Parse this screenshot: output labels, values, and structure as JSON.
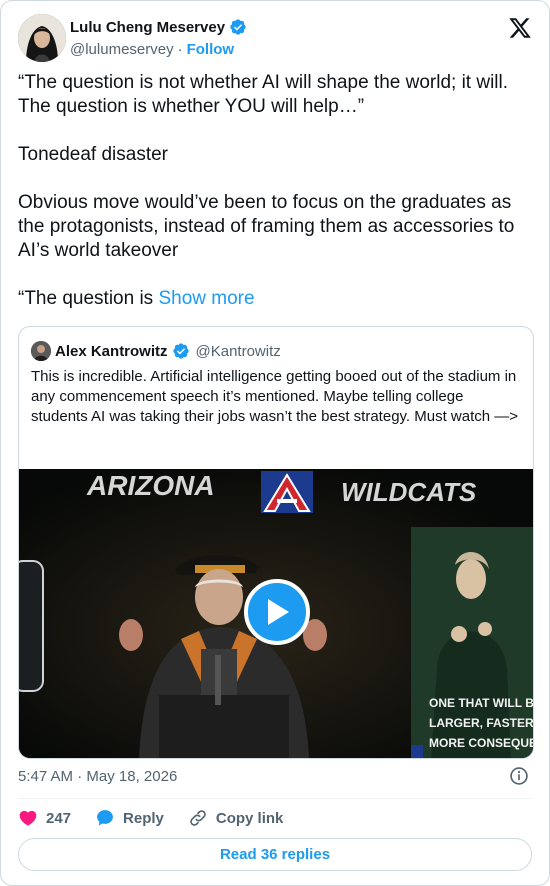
{
  "author": {
    "name": "Lulu Cheng Meservey",
    "handle": "@lulumeservey",
    "separator": "·",
    "follow_label": "Follow"
  },
  "tweet": {
    "paragraphs": [
      "“The question is not whether AI will shape the world; it will. The question is whether YOU will help…”",
      "Tonedeaf disaster",
      "Obvious move would’ve been to focus on the graduates as the protagonists, instead of framing them as accessories to AI’s world takeover"
    ],
    "last_fragment": "“The question is ",
    "show_more_label": "Show more"
  },
  "quoted": {
    "name": "Alex Kantrowitz",
    "handle": "@Kantrowitz",
    "text": "This is incredible. Artificial intelligence getting booed out of the stadium in any commencement speech it’s mentioned. Maybe telling college students AI was taking their jobs wasn’t the best strategy. Must watch —>",
    "video": {
      "banner_left": "ARIZONA",
      "banner_right": "WILDCATS",
      "caption_line1": "ONE THAT WILL BE",
      "caption_line2": "LARGER, FASTER, AN",
      "caption_line3": "MORE CONSEQUENT"
    }
  },
  "meta": {
    "time": "5:47 AM",
    "date": "May 18, 2026",
    "separator": "·"
  },
  "actions": {
    "like_count": "247",
    "reply_label": "Reply",
    "copy_label": "Copy link"
  },
  "read_replies_label": "Read 36 replies",
  "colors": {
    "accent": "#1d9bf0",
    "like": "#f91880",
    "muted": "#536471",
    "text": "#0f1419",
    "border": "#cfd9de"
  }
}
